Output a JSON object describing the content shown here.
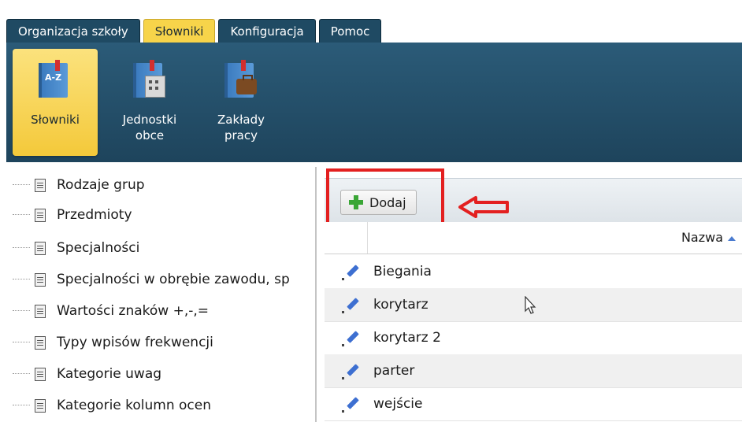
{
  "menu": {
    "tabs": [
      {
        "label": "Organizacja szkoły",
        "active": false
      },
      {
        "label": "Słowniki",
        "active": true
      },
      {
        "label": "Konfiguracja",
        "active": false
      },
      {
        "label": "Pomoc",
        "active": false
      }
    ]
  },
  "ribbon": {
    "buttons": [
      {
        "label_line1": "Słowniki",
        "label_line2": "",
        "icon": "dictionary-book-icon",
        "active": true
      },
      {
        "label_line1": "Jednostki",
        "label_line2": "obce",
        "icon": "building-book-icon",
        "active": false
      },
      {
        "label_line1": "Zakłady",
        "label_line2": "pracy",
        "icon": "briefcase-book-icon",
        "active": false
      }
    ]
  },
  "tree": {
    "items": [
      {
        "label": "Rodzaje grup"
      },
      {
        "label": "Przedmioty"
      },
      {
        "label": "Specjalności"
      },
      {
        "label": "Specjalności w obrębie zawodu, sp"
      },
      {
        "label": "Wartości znaków +,-,="
      },
      {
        "label": "Typy wpisów frekwencji"
      },
      {
        "label": "Kategorie uwag"
      },
      {
        "label": "Kategorie kolumn ocen"
      }
    ]
  },
  "grid": {
    "add_label": "Dodaj",
    "column_header": "Nazwa",
    "rows": [
      {
        "value": "Biegania"
      },
      {
        "value": "korytarz"
      },
      {
        "value": "korytarz 2"
      },
      {
        "value": "parter"
      },
      {
        "value": "wejście"
      }
    ]
  },
  "colors": {
    "active_tab": "#f7d44a",
    "ribbon": "#24506b",
    "highlight": "#e32020",
    "add_plus": "#3aa636"
  }
}
